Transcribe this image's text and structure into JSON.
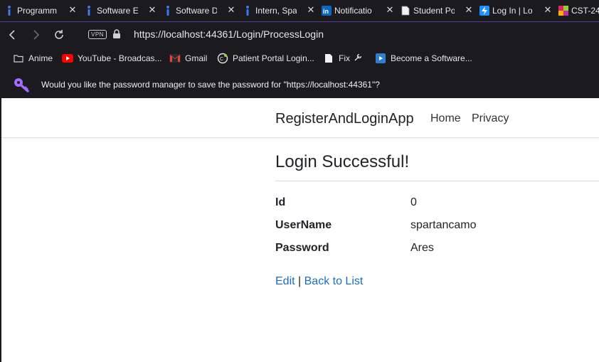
{
  "tabs": [
    {
      "label": "Programm",
      "icon": "info-i-icon"
    },
    {
      "label": "Software E",
      "icon": "info-i-icon"
    },
    {
      "label": "Software D",
      "icon": "info-i-icon"
    },
    {
      "label": "Intern, Spa",
      "icon": "info-i-icon"
    },
    {
      "label": "Notificatio",
      "icon": "linkedin-icon"
    },
    {
      "label": "Student Po",
      "icon": "document-icon"
    },
    {
      "label": "Log In | Lo",
      "icon": "bolt-icon"
    },
    {
      "label": "CST-24",
      "icon": "colorful-grid-icon"
    }
  ],
  "toolbar": {
    "vpn_label": "VPN",
    "url_prefix": "https://",
    "url_host": "localhost",
    "url_rest": ":44361/Login/ProcessLogin"
  },
  "bookmarks": [
    {
      "label": "Anime",
      "icon": "folder-icon"
    },
    {
      "label": "YouTube - Broadcas...",
      "icon": "youtube-icon"
    },
    {
      "label": "Gmail",
      "icon": "gmail-icon"
    },
    {
      "label": "Patient Portal Login...",
      "icon": "portal-icon"
    },
    {
      "label": "Fix",
      "icon": "document-icon"
    },
    {
      "label": "Become a Software...",
      "icon": "video-icon"
    }
  ],
  "infobar": {
    "message": "Would you like the password manager to save the password for \"https://localhost:44361\"?"
  },
  "site": {
    "brand": "RegisterAndLoginApp",
    "nav": [
      "Home",
      "Privacy"
    ],
    "heading": "Login Successful!",
    "fields": [
      {
        "label": "Id",
        "value": "0"
      },
      {
        "label": "UserName",
        "value": "spartancamo"
      },
      {
        "label": "Password",
        "value": "Ares"
      }
    ],
    "edit_link": "Edit",
    "separator": " | ",
    "back_link": "Back to List"
  },
  "colors": {
    "chrome_bg": "#1b1a1e",
    "link": "#1b6ec2",
    "accent_purple": "#a36bff"
  }
}
